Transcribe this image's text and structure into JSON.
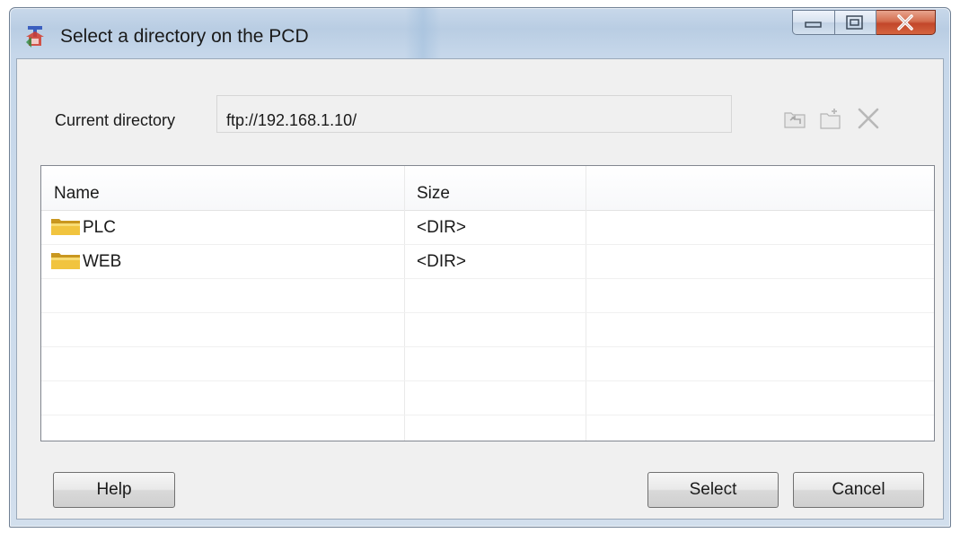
{
  "window": {
    "title": "Select a directory on the PCD"
  },
  "current_directory": {
    "label": "Current directory",
    "value": "ftp://192.168.1.10/"
  },
  "toolbar": {
    "icons": [
      "parent-directory-icon",
      "new-folder-icon",
      "delete-icon"
    ]
  },
  "list": {
    "columns": [
      "Name",
      "Size",
      ""
    ],
    "rows": [
      {
        "name": "PLC",
        "size": "<DIR>",
        "icon": "folder-icon"
      },
      {
        "name": "WEB",
        "size": "<DIR>",
        "icon": "folder-icon"
      }
    ]
  },
  "buttons": {
    "help": "Help",
    "select": "Select",
    "cancel": "Cancel"
  }
}
